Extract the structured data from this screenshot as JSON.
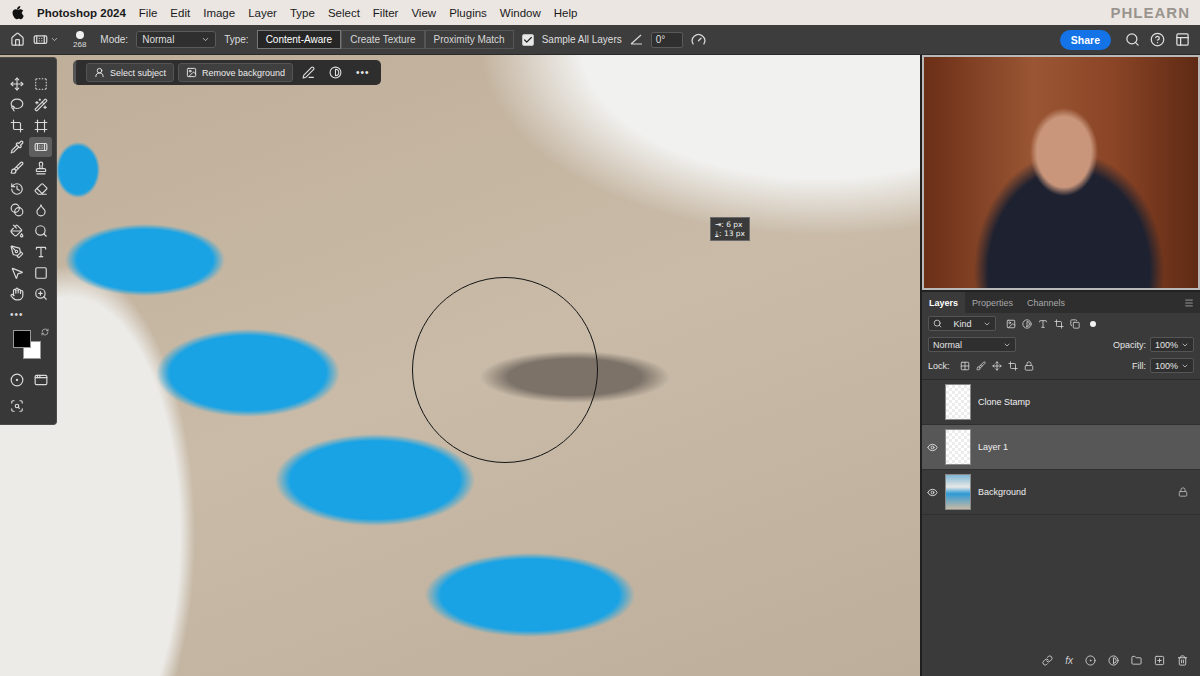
{
  "menubar": {
    "app": "Photoshop 2024",
    "items": [
      "File",
      "Edit",
      "Image",
      "Layer",
      "Type",
      "Select",
      "Filter",
      "View",
      "Plugins",
      "Window",
      "Help"
    ],
    "watermark": "PHLEARN"
  },
  "options_bar": {
    "brush_size": "268",
    "mode_label": "Mode:",
    "mode": "Normal",
    "type_label": "Type:",
    "types": [
      {
        "label": "Content-Aware",
        "selected": true
      },
      {
        "label": "Create Texture",
        "selected": false
      },
      {
        "label": "Proximity Match",
        "selected": false
      }
    ],
    "sample_all_layers": {
      "label": "Sample All Layers",
      "checked": true
    },
    "angle": "0°",
    "share": "Share"
  },
  "task_bar": {
    "buttons": [
      "Select subject",
      "Remove background"
    ],
    "more": "•••"
  },
  "toolbar": {
    "tools": [
      {
        "selected": false
      },
      {
        "selected": false
      },
      {
        "selected": false
      },
      {
        "selected": false
      },
      {
        "selected": false
      },
      {
        "selected": false
      },
      {
        "selected": false
      },
      {
        "selected": true
      },
      {
        "selected": false
      },
      {
        "selected": false
      },
      {
        "selected": false
      },
      {
        "selected": false
      },
      {
        "selected": false
      },
      {
        "selected": false
      },
      {
        "selected": false
      },
      {
        "selected": false
      },
      {
        "selected": false
      },
      {
        "selected": false
      },
      {
        "selected": false
      },
      {
        "selected": false
      },
      {
        "selected": false
      },
      {
        "selected": false
      }
    ],
    "more": "•••",
    "foreground": "#000000",
    "background": "#ffffff"
  },
  "measure_tooltip": {
    "lines": [
      "⇥: 6 px",
      "⤓: 13 px"
    ]
  },
  "layers_panel": {
    "tabs": [
      {
        "label": "Layers",
        "selected": true
      },
      {
        "label": "Properties",
        "selected": false
      },
      {
        "label": "Channels",
        "selected": false
      }
    ],
    "filter": "Kind",
    "blend_mode": "Normal",
    "opacity_label": "Opacity:",
    "opacity": "100%",
    "lock_label": "Lock:",
    "fill_label": "Fill:",
    "fill": "100%",
    "layers": [
      {
        "name": "Clone Stamp",
        "visible": false,
        "selected": false,
        "locked": false,
        "kind": "transparent"
      },
      {
        "name": "Layer 1",
        "visible": true,
        "selected": true,
        "locked": false,
        "kind": "transparent"
      },
      {
        "name": "Background",
        "visible": true,
        "selected": false,
        "locked": true,
        "kind": "image"
      }
    ],
    "footer_fx": "fx"
  }
}
